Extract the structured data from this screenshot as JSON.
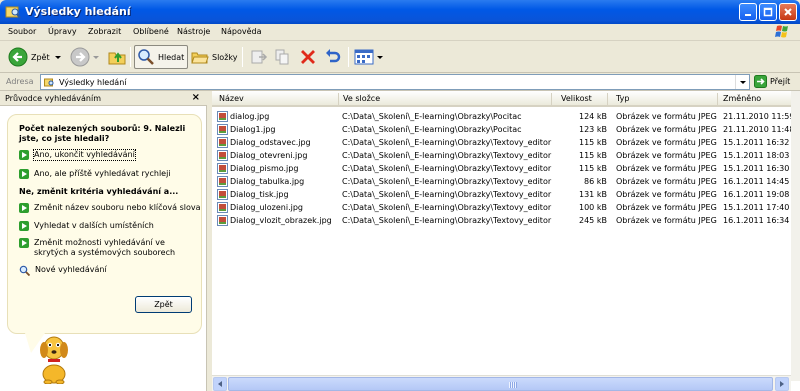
{
  "window": {
    "title": "Výsledky hledání",
    "colors": {
      "titlebar": "#0058e6",
      "close": "#c63813"
    }
  },
  "menu": {
    "items": [
      {
        "label": "Soubor"
      },
      {
        "label": "Úpravy"
      },
      {
        "label": "Zobrazit"
      },
      {
        "label": "Oblíbené"
      },
      {
        "label": "Nástroje"
      },
      {
        "label": "Nápověda"
      }
    ]
  },
  "toolbar": {
    "back_label": "Zpět",
    "search_label": "Hledat",
    "folders_label": "Složky"
  },
  "address": {
    "label": "Adresa",
    "value": "Výsledky hledání",
    "go_label": "Přejít"
  },
  "search_pane": {
    "title": "Průvodce vyhledáváním",
    "heading": "Počet nalezených souborů: 9. Nalezli jste, co jste hledali?",
    "options_top": [
      {
        "label": "Ano, ukončit vyhledávání"
      },
      {
        "label": "Ano, ale příště vyhledávat rychleji"
      }
    ],
    "subheading": "Ne, změnit kritéria vyhledávání a...",
    "options_change": [
      {
        "label": "Změnit název souboru nebo klíčová slova"
      },
      {
        "label": "Vyhledat v dalších umístěních"
      },
      {
        "label": "Změnit možnosti vyhledávání ve skrytých a systémových souborech"
      }
    ],
    "new_search_label": "Nové vyhledávání",
    "back_button": "Zpět"
  },
  "file_list": {
    "columns": {
      "name": "Název",
      "folder": "Ve složce",
      "size": "Velikost",
      "type": "Typ",
      "modified": "Změněno"
    },
    "rows": [
      {
        "name": "dialog.jpg",
        "folder": "C:\\Data\\_Skolení\\_E-learning\\Obrazky\\Pocitac",
        "size": "124 kB",
        "type": "Obrázek ve formátu JPEG",
        "modified": "21.11.2010 11:59"
      },
      {
        "name": "Dialog1.jpg",
        "folder": "C:\\Data\\_Skolení\\_E-learning\\Obrazky\\Pocitac",
        "size": "123 kB",
        "type": "Obrázek ve formátu JPEG",
        "modified": "21.11.2010 11:48"
      },
      {
        "name": "Dialog_odstavec.jpg",
        "folder": "C:\\Data\\_Skolení\\_E-learning\\Obrazky\\Textovy_editor",
        "size": "115 kB",
        "type": "Obrázek ve formátu JPEG",
        "modified": "15.1.2011 16:32"
      },
      {
        "name": "Dialog_otevreni.jpg",
        "folder": "C:\\Data\\_Skolení\\_E-learning\\Obrazky\\Textovy_editor",
        "size": "115 kB",
        "type": "Obrázek ve formátu JPEG",
        "modified": "15.1.2011 18:03"
      },
      {
        "name": "Dialog_pismo.jpg",
        "folder": "C:\\Data\\_Skolení\\_E-learning\\Obrazky\\Textovy_editor",
        "size": "115 kB",
        "type": "Obrázek ve formátu JPEG",
        "modified": "15.1.2011 16:30"
      },
      {
        "name": "Dialog_tabulka.jpg",
        "folder": "C:\\Data\\_Skolení\\_E-learning\\Obrazky\\Textovy_editor",
        "size": "86 kB",
        "type": "Obrázek ve formátu JPEG",
        "modified": "16.1.2011 14:45"
      },
      {
        "name": "Dialog_tisk.jpg",
        "folder": "C:\\Data\\_Skolení\\_E-learning\\Obrazky\\Textovy_editor",
        "size": "131 kB",
        "type": "Obrázek ve formátu JPEG",
        "modified": "16.1.2011 19:08"
      },
      {
        "name": "Dialog_ulozeni.jpg",
        "folder": "C:\\Data\\_Skolení\\_E-learning\\Obrazky\\Textovy_editor",
        "size": "100 kB",
        "type": "Obrázek ve formátu JPEG",
        "modified": "15.1.2011 17:40"
      },
      {
        "name": "Dialog_vlozit_obrazek.jpg",
        "folder": "C:\\Data\\_Skolení\\_E-learning\\Obrazky\\Textovy_editor",
        "size": "245 kB",
        "type": "Obrázek ve formátu JPEG",
        "modified": "16.1.2011 16:34"
      }
    ]
  }
}
